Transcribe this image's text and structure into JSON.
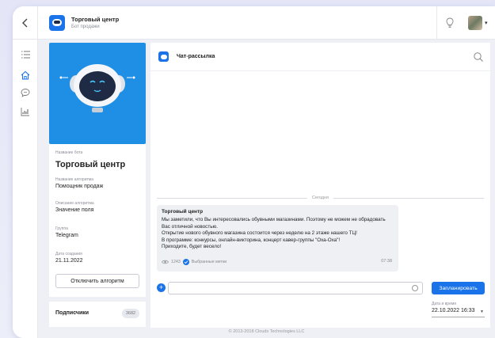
{
  "header": {
    "title": "Торговый центр",
    "subtitle": "Бот продажи",
    "back_icon": "chevron-left-icon",
    "bulb_icon": "lightbulb-icon"
  },
  "rail": {
    "items": [
      {
        "icon": "list-icon"
      },
      {
        "icon": "home-icon"
      },
      {
        "icon": "chat-bubble-icon"
      },
      {
        "icon": "chart-icon"
      }
    ]
  },
  "bot": {
    "name_label": "Название бота",
    "name": "Торговый центр",
    "algorithm_label": "Название алгоритма",
    "algorithm": "Помощник продаж",
    "description_label": "Описание алгоритма",
    "description": "Значение поля",
    "group_label": "Группа",
    "group": "Telegram",
    "created_label": "Дата создания",
    "created": "21.11.2022",
    "disable_button": "Отключить алгоритм"
  },
  "subscribers": {
    "label": "Подписчики",
    "count": "3682"
  },
  "chat": {
    "title": "Чат-рассылка",
    "date_divider": "Сегодня",
    "message": {
      "from": "Торговый центр",
      "text": "Мы заметили, что Вы интересовались обувными магазинами. Поэтому не можем не обрадовать Вас отличной новостью.\nОткрытие нового обувного магазина состоится через неделю на 2 этаже нашего ТЦ!\nВ программе: конкурсы, онлайн-викторина, концерт кавер-группы \"Оха-Оха\"!\nПриходите, будет весело!",
      "views": "1243",
      "tags": "Выбранные метки",
      "time": "07:38"
    },
    "input_placeholder": "",
    "schedule_button": "Запланировать",
    "datetime_label": "Дата и время",
    "datetime_value": "22.10.2022 16:33"
  },
  "footer": "© 2013-2018 Clouds Technologies LLC",
  "colors": {
    "accent": "#1a73e8",
    "bot_card_bg": "#1f8fe6"
  }
}
